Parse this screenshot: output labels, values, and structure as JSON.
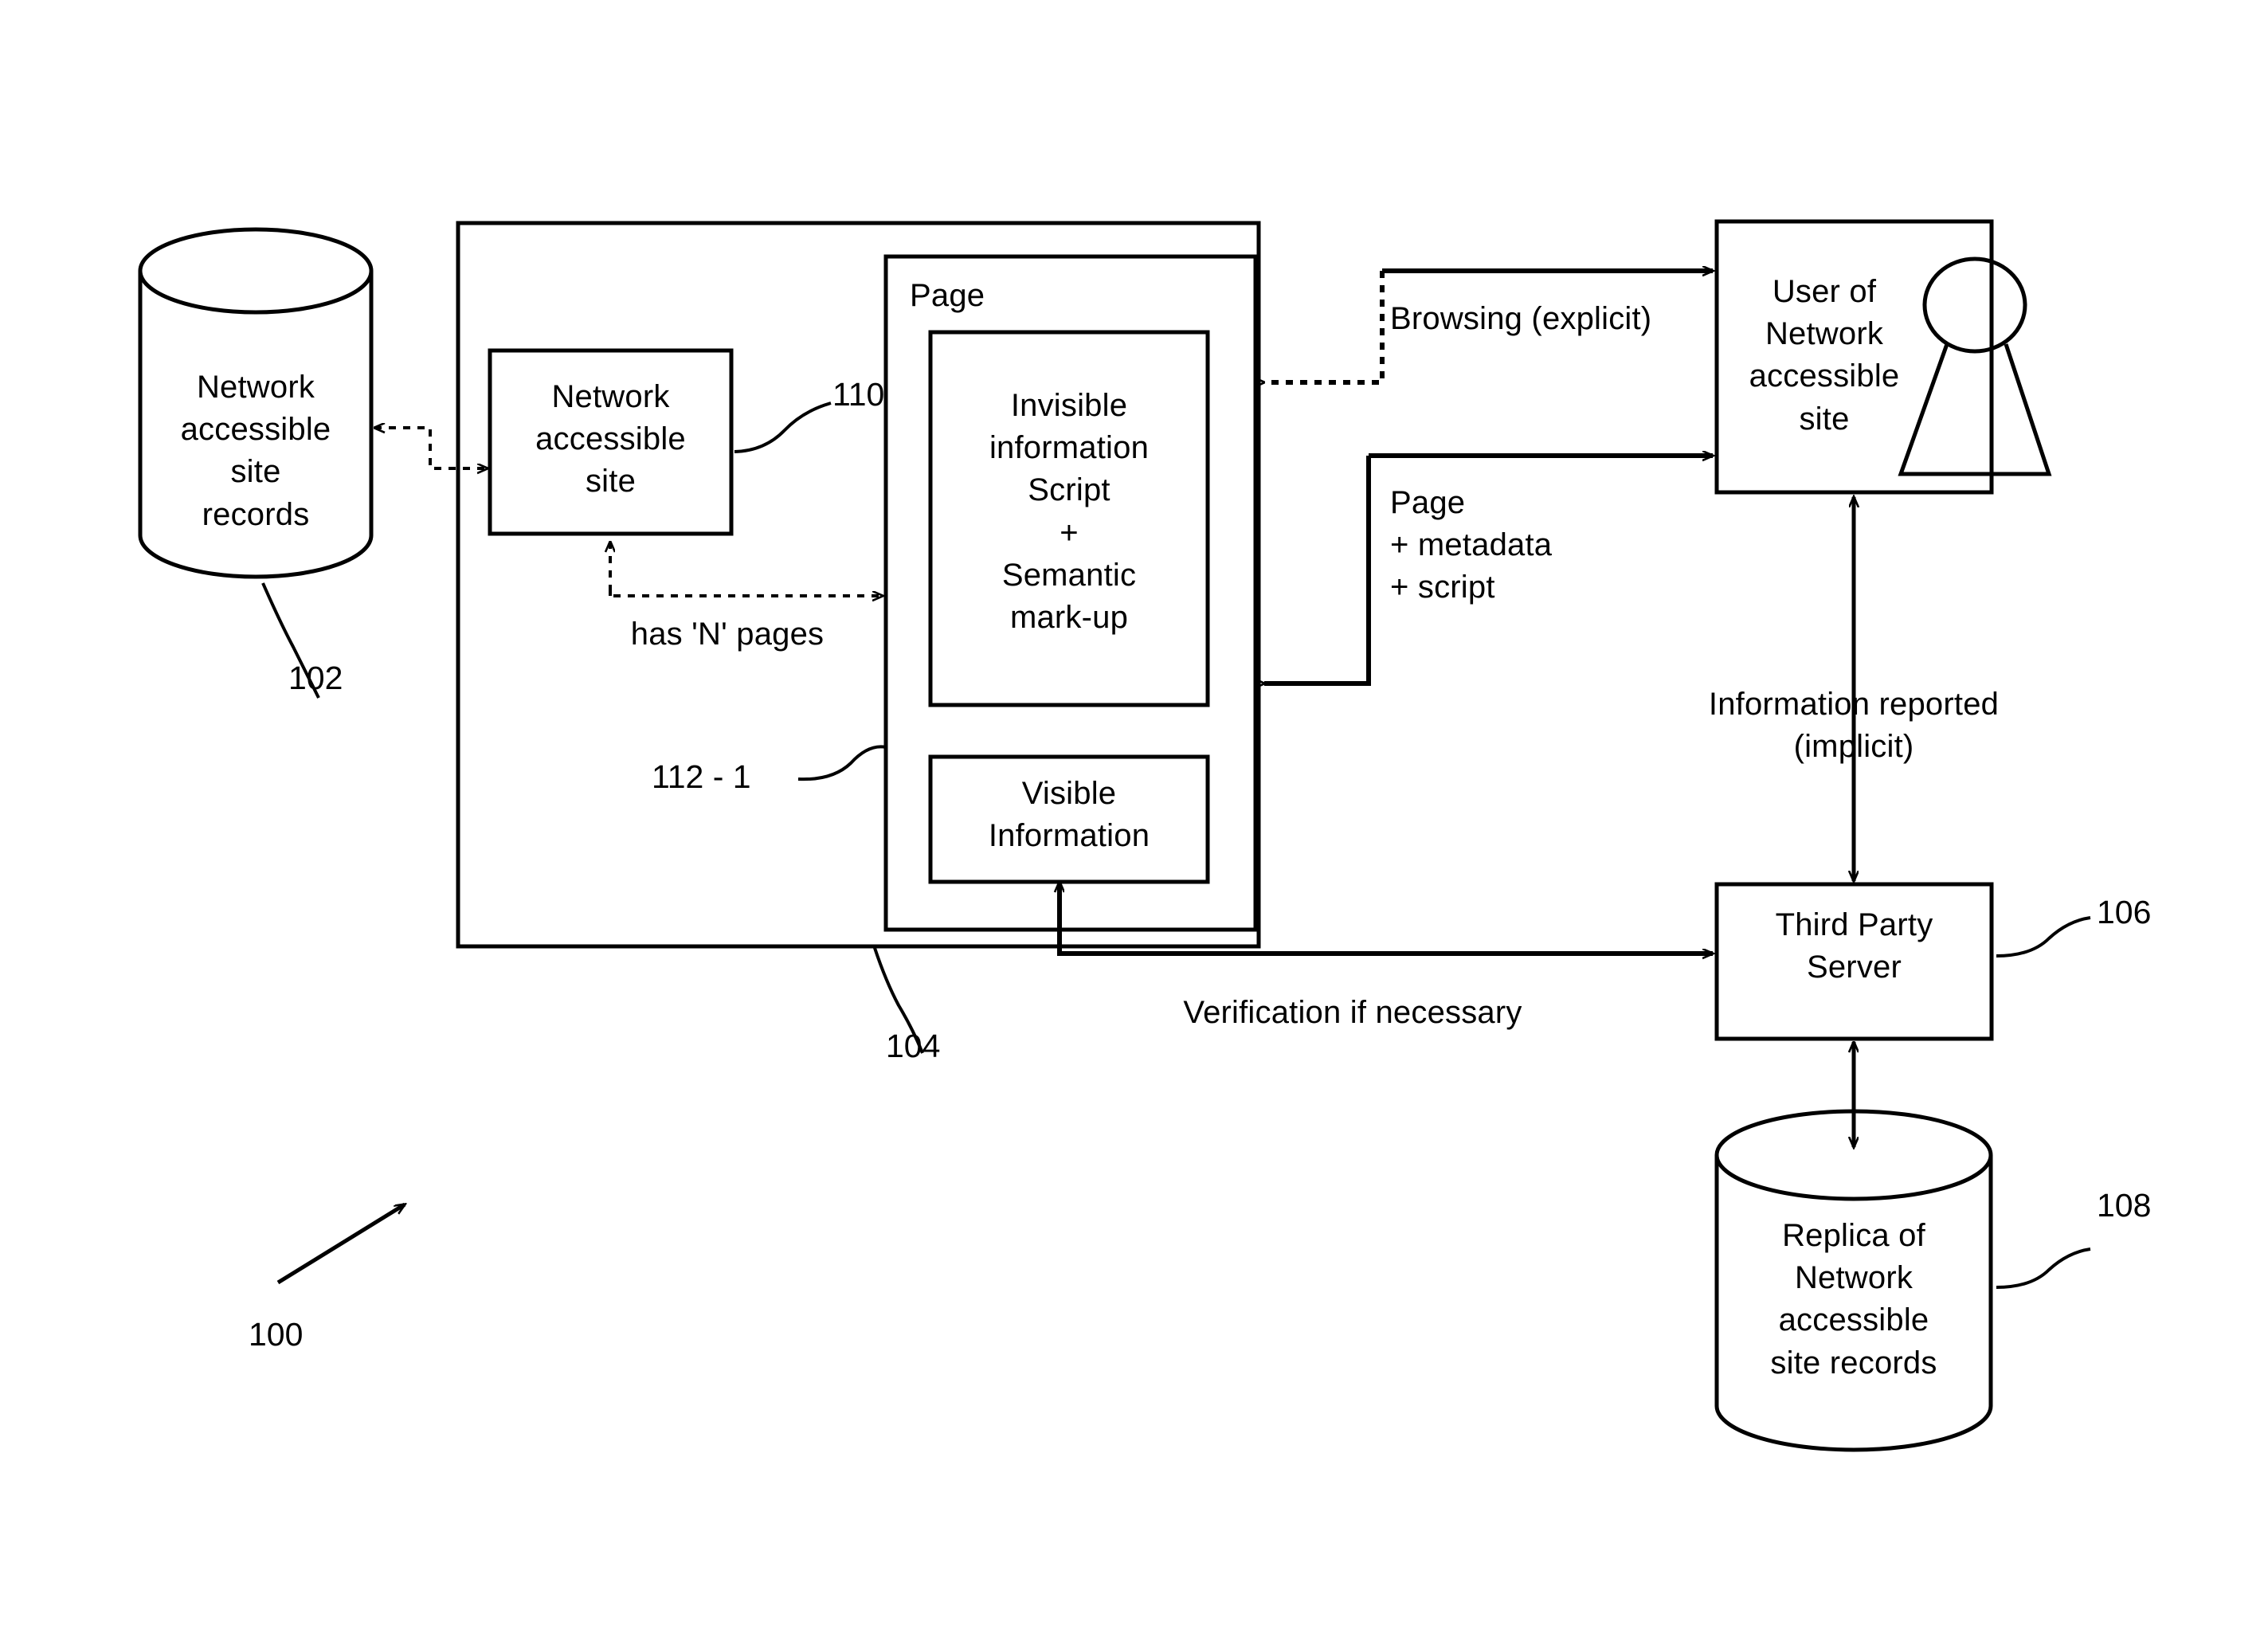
{
  "figure": {
    "number": "100",
    "type": "patent-flow-diagram"
  },
  "nodes": {
    "records_db": {
      "label": "Network\naccessible\nsite\nrecords",
      "ref": "102",
      "shape": "cylinder"
    },
    "system_boundary": {
      "ref": "104",
      "shape": "rectangle"
    },
    "network_site": {
      "label": "Network\naccessible\nsite",
      "ref": "110",
      "shape": "rectangle"
    },
    "page": {
      "title": "Page",
      "ref": "112 - 1",
      "shape": "rectangle"
    },
    "invisible_info": {
      "label": "Invisible\ninformation\nScript\n+\nSemantic\nmark-up",
      "shape": "rectangle"
    },
    "visible_info": {
      "label": "Visible\nInformation",
      "shape": "rectangle"
    },
    "user": {
      "label": "User of\nNetwork\naccessible\nsite",
      "shape": "rectangle-with-person"
    },
    "third_party_server": {
      "label": "Third Party\nServer",
      "ref": "106",
      "shape": "rectangle"
    },
    "replica_db": {
      "label": "Replica of\nNetwork\naccessible\nsite records",
      "ref": "108",
      "shape": "cylinder"
    }
  },
  "edges": {
    "has_n_pages": "has 'N' pages",
    "browsing": "Browsing (explicit)",
    "page_metadata_script": "Page\n+ metadata\n+ script",
    "information_reported": "Information reported\n(implicit)",
    "verification": "Verification if necessary"
  },
  "colors": {
    "stroke": "#000000",
    "background": "#ffffff"
  }
}
